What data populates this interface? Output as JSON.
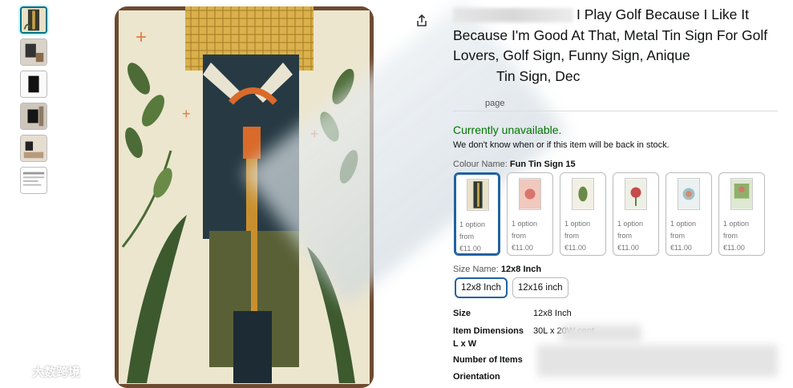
{
  "product": {
    "title_visible": "I Play Golf Because I Like It Because I'm Good At That, Metal Tin Sign For Golf Lovers, Golf Sign, Funny Sign, Anique",
    "title_line4": "Tin Sign, Dec",
    "store_link_fragment": "page"
  },
  "availability": {
    "status": "Currently unavailable.",
    "note": "We don't know when or if this item will be back in stock."
  },
  "colour": {
    "label": "Colour Name:",
    "selected": "Fun Tin Sign 15",
    "options": [
      {
        "line1": "1 option",
        "line2": "from",
        "price": "€11.00",
        "selected": true
      },
      {
        "line1": "1 option",
        "line2": "from",
        "price": "€11.00",
        "selected": false
      },
      {
        "line1": "1 option",
        "line2": "from",
        "price": "€11.00",
        "selected": false
      },
      {
        "line1": "1 option",
        "line2": "from",
        "price": "€11.00",
        "selected": false
      },
      {
        "line1": "1 option",
        "line2": "from",
        "price": "€11.00",
        "selected": false
      },
      {
        "line1": "1 option",
        "line2": "from",
        "price": "€11.00",
        "selected": false
      }
    ]
  },
  "size": {
    "label": "Size Name:",
    "selected": "12x8 Inch",
    "options": [
      "12x8 Inch",
      "12x16 inch"
    ]
  },
  "specs": [
    {
      "key": "Size",
      "value": "12x8 Inch"
    },
    {
      "key": "Item Dimensions L x W",
      "value": "30L x 20W cent"
    },
    {
      "key": "Number of Items",
      "value": ""
    },
    {
      "key": "Orientation",
      "value": ""
    }
  ],
  "watermark": "大数跨境",
  "icons": {
    "share": "share-icon"
  },
  "colors": {
    "accent": "#2162a1",
    "availability": "#007600",
    "link": "#007185"
  }
}
